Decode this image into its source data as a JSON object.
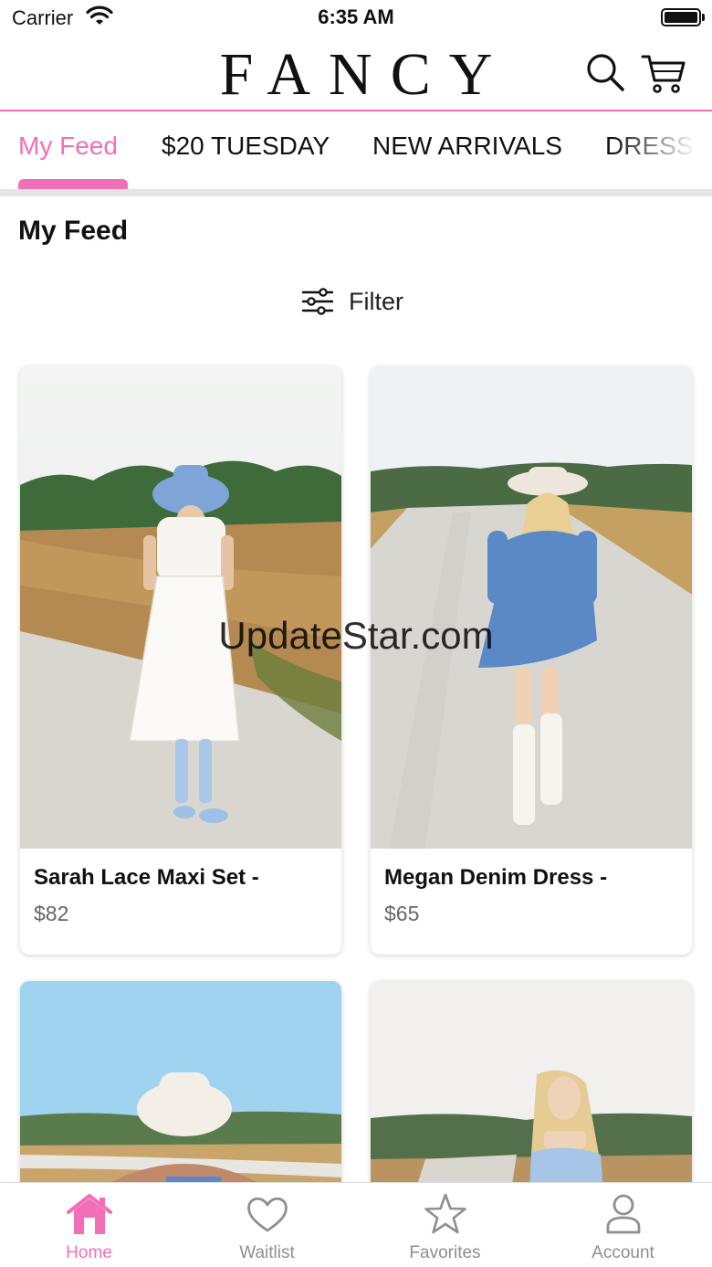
{
  "status_bar": {
    "carrier": "Carrier",
    "time": "6:35 AM"
  },
  "header": {
    "logo": "FANCY",
    "icons": [
      "search-icon",
      "cart-icon"
    ]
  },
  "tabs": [
    {
      "label": "My Feed",
      "active": true
    },
    {
      "label": "$20 TUESDAY",
      "active": false
    },
    {
      "label": "NEW ARRIVALS",
      "active": false
    },
    {
      "label": "DRESS",
      "active": false
    }
  ],
  "page": {
    "title": "My Feed",
    "filter_label": "Filter"
  },
  "products": [
    {
      "name": "Sarah Lace Maxi Set -",
      "price": "$82"
    },
    {
      "name": "Megan Denim Dress -",
      "price": "$65"
    },
    {
      "name": "",
      "price": ""
    },
    {
      "name": "",
      "price": ""
    }
  ],
  "watermark": "UpdateStar.com",
  "bottom_nav": [
    {
      "label": "Home",
      "icon": "home-icon",
      "active": true
    },
    {
      "label": "Waitlist",
      "icon": "heart-icon",
      "active": false
    },
    {
      "label": "Favorites",
      "icon": "star-icon",
      "active": false
    },
    {
      "label": "Account",
      "icon": "account-icon",
      "active": false
    }
  ],
  "colors": {
    "accent": "#f26fb7",
    "inactive": "#8e8e93"
  }
}
